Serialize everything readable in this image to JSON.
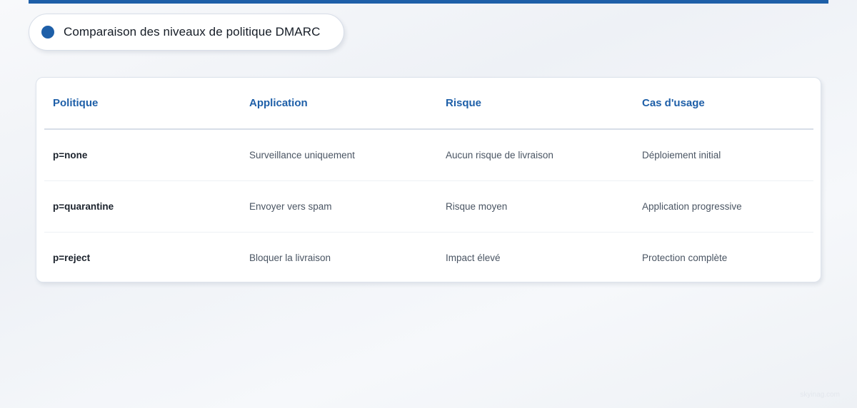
{
  "colors": {
    "accent": "#1e5fa8",
    "header_text": "#1e5fa8",
    "cell_text": "#4a5563"
  },
  "header": {
    "title": "Comparaison des niveaux de politique DMARC"
  },
  "table": {
    "columns": [
      "Politique",
      "Application",
      "Risque",
      "Cas d'usage"
    ],
    "rows": [
      [
        "p=none",
        "Surveillance uniquement",
        "Aucun risque de livraison",
        "Déploiement initial"
      ],
      [
        "p=quarantine",
        "Envoyer vers spam",
        "Risque moyen",
        "Application progressive"
      ],
      [
        "p=reject",
        "Bloquer la livraison",
        "Impact élevé",
        "Protection complète"
      ]
    ]
  },
  "footer": {
    "watermark": "skyinag.com"
  }
}
